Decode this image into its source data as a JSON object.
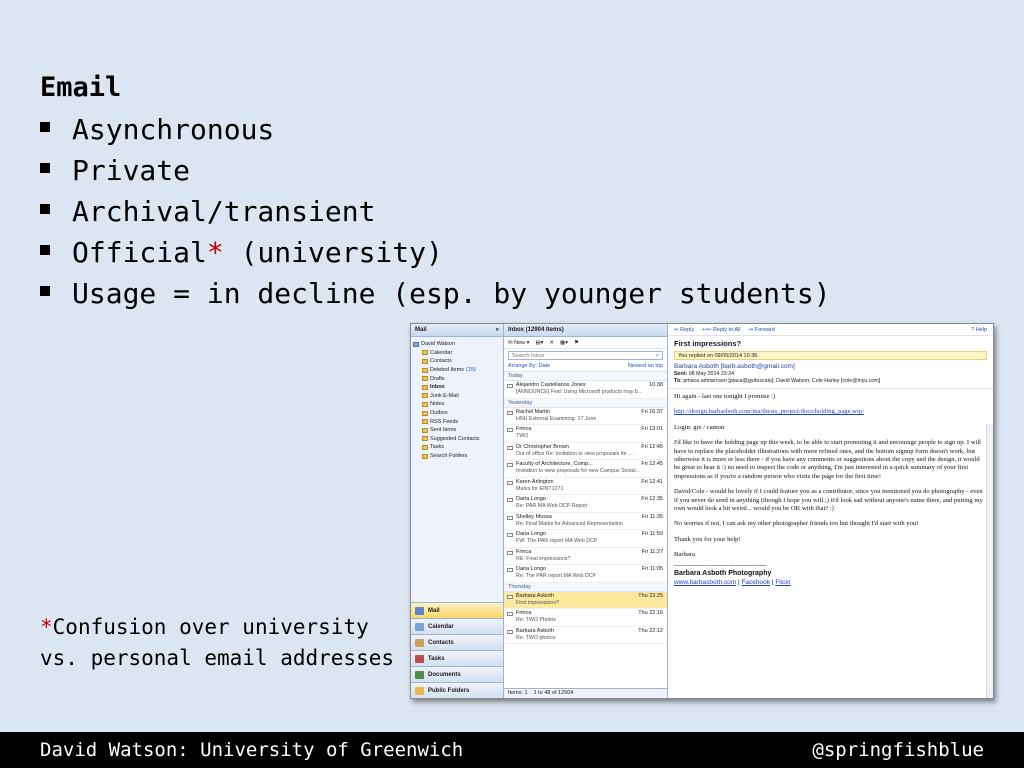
{
  "slide": {
    "heading": "Email",
    "bullets": [
      {
        "text": "Asynchronous"
      },
      {
        "text": "Private"
      },
      {
        "text": "Archival/transient"
      },
      {
        "text": "Official",
        "star": "*",
        "rest": " (university)"
      },
      {
        "text": "Usage = in decline (esp. by younger students)"
      }
    ],
    "footnote": {
      "star": "*",
      "text": "Confusion over university vs. personal email addresses"
    },
    "footer_left": "David Watson: University of Greenwich",
    "footer_right": "@springfishblue"
  },
  "outlook": {
    "nav": {
      "title": "Mail",
      "collapse_glyph": "«",
      "folders": [
        {
          "label": "David Watson",
          "level": 0
        },
        {
          "label": "Calendar",
          "level": 1
        },
        {
          "label": "Contacts",
          "level": 1
        },
        {
          "label": "Deleted Items",
          "count": "(15)",
          "level": 1
        },
        {
          "label": "Drafts",
          "level": 1
        },
        {
          "label": "Inbox",
          "level": 1,
          "bold": true
        },
        {
          "label": "Junk E-Mail",
          "level": 1
        },
        {
          "label": "Notes",
          "level": 1
        },
        {
          "label": "Outbox",
          "level": 1
        },
        {
          "label": "RSS Feeds",
          "level": 1
        },
        {
          "label": "Sent Items",
          "level": 1
        },
        {
          "label": "Suggested Contacts",
          "level": 1
        },
        {
          "label": "Tasks",
          "level": 1
        },
        {
          "label": "Search Folders",
          "level": 1
        }
      ],
      "buttons": [
        {
          "label": "Mail",
          "active": true
        },
        {
          "label": "Calendar"
        },
        {
          "label": "Contacts"
        },
        {
          "label": "Tasks"
        },
        {
          "label": "Documents"
        },
        {
          "label": "Public Folders"
        }
      ]
    },
    "list": {
      "title": "Inbox (12904 Items)",
      "toolbar_new": "New",
      "search_placeholder": "Search Inbox",
      "arrange_by": "Arrange By: Date",
      "sort": "Newest on top",
      "groups": [
        {
          "name": "Today",
          "items": [
            {
              "from": "Alejandro Castellanos Jones",
              "time": "10:38",
              "preview": "[ANNOUNCE] Fwd: Using Microsoft products may b..."
            }
          ]
        },
        {
          "name": "Yesterday",
          "items": [
            {
              "from": "Rachel Martin",
              "time": "Fri 16:37",
              "preview": "HNU External Examining: 17 June"
            },
            {
              "from": "Frinca",
              "time": "Fri 13:01",
              "preview": "TWO"
            },
            {
              "from": "Dr Christopher Brown",
              "time": "Fri 12:45",
              "preview": "Out of office Re: Invitation to view proposals for ..."
            },
            {
              "from": "Faculty of Architecture, Comp...",
              "time": "Fri 12:45",
              "preview": "Invitation to view proposals for new Campus Social..."
            },
            {
              "from": "Karen Arlington",
              "time": "Fri 12:41",
              "preview": "Marks for EINT1271"
            },
            {
              "from": "Daria Longo",
              "time": "Fri 12:35",
              "preview": "Re: PAR MA Web DCP Report"
            },
            {
              "from": "Shelley Mossa",
              "time": "Fri 11:35",
              "preview": "Re: Final Marks for Advanced Representation"
            },
            {
              "from": "Daria Longo",
              "time": "Fri 11:59",
              "preview": "FW: The PAR report MA Web DCP"
            },
            {
              "from": "Frinca",
              "time": "Fri 11:27",
              "preview": "RE: Final impressions?"
            },
            {
              "from": "Daria Longo",
              "time": "Fri 11:05",
              "preview": "Re: The PAR report MA Web DCP"
            }
          ]
        },
        {
          "name": "Thursday",
          "items": [
            {
              "from": "Barbara Asboth",
              "time": "Thu 23:25",
              "preview": "First impressions?",
              "selected": true
            },
            {
              "from": "Frinca",
              "time": "Thu 22:16",
              "preview": "Re: TWO Photos"
            },
            {
              "from": "Barbara Asboth",
              "time": "Thu 22:12",
              "preview": "Re: TWO photos"
            }
          ]
        }
      ],
      "status_items": "Items: 1",
      "status_range": "1 to 48 of 12904"
    },
    "reading": {
      "toolbar": {
        "reply": "Reply",
        "reply_all": "Reply to All",
        "forward": "Forward",
        "help": "Help"
      },
      "subject": "First impressions?",
      "replied_banner": "You replied on 09/05/2014 10:36.",
      "from": "Barbara Asboth [barb.asboth@gmail.com]",
      "sent_label": "Sent:",
      "sent_value": "08 May 2014 23:24",
      "to_label": "To:",
      "to_value": "pmaca admarcsen [piaca@gydoscalu]; David Watson; Cole Harley [cole@inyu.com]",
      "body": {
        "greeting": "Hi again - last one tonight I promise :)",
        "link": "http://design.barbasboth.com/ma/thesis_project/docs/holding_page.wip/",
        "login": "Login: gre / camon",
        "p1": "I'd like to have the holding page up this week, to be able to start promoting it and encourage people to sign up. I will have to replace the placeholder illustrations with more refined ones, and the bottom signup form doesn't work, but otherwise it is more or less there - if you have any comments or suggestions about the copy and the design, it would be great to hear it :) no need to inspect the code or anything, I'm just interested in a quick summary of your first impressions as if you're a random person who visits the page for the first time!",
        "p2": "David/Cole - would be lovely if I could feature you as a contributor, since you mentioned you do photography - even if you never do send in anything (though I hope you will ;) it'd look sad without anyone's name there, and putting my own would look a bit weird... would you be OK with that? :)",
        "p3": "No worries if not, I can ask my other photographer friends too but thought I'd start with you!",
        "thanks": "Thank you for your help!",
        "signoff": "Barbara",
        "rule": "------------------------------------------",
        "sig_name": "Barbara Asboth Photography",
        "sig_links": [
          "www.barbasboth.com",
          "Facebook",
          "Flickr"
        ]
      }
    }
  }
}
